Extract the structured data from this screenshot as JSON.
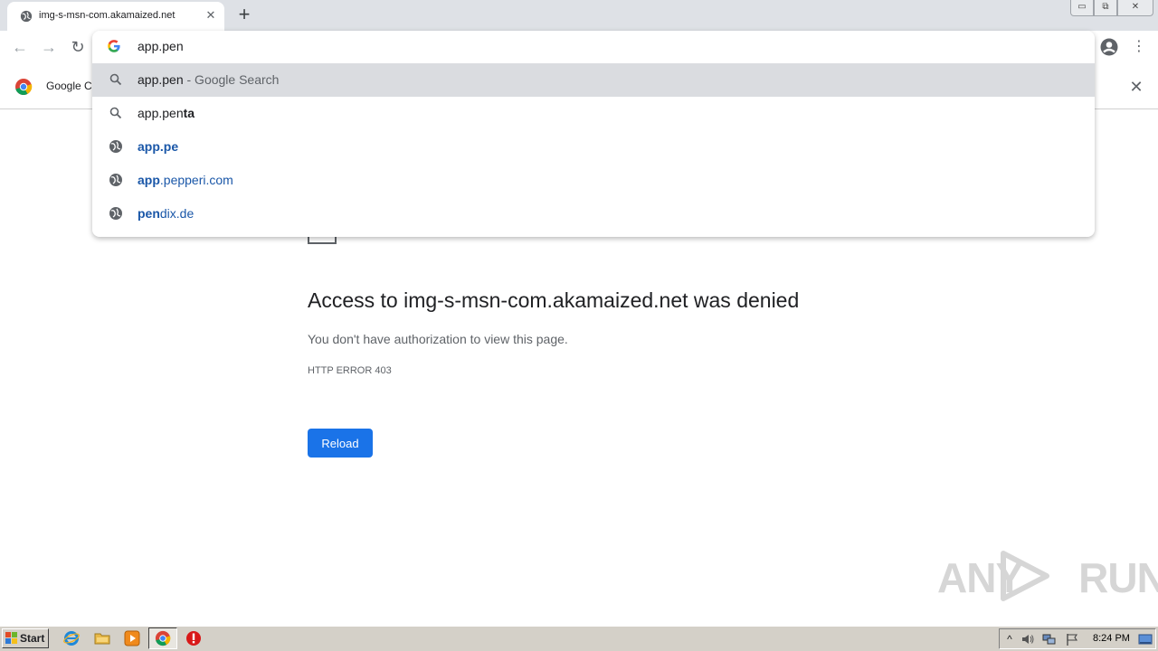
{
  "browser": {
    "tab": {
      "title": "img-s-msn-com.akamaized.net",
      "close": "✕"
    },
    "new_tab": "+",
    "window_controls": {
      "minimize": "▭",
      "maximize": "⧉",
      "close": "✕"
    },
    "nav": {
      "back": "←",
      "forward": "→",
      "reload": "↻"
    },
    "omnibox": {
      "value": "app.pen",
      "suggestions": [
        {
          "icon": "search-icon",
          "main": "app.pen",
          "secondary": " - Google Search",
          "selected": true
        },
        {
          "icon": "search-icon",
          "prefix": "app.pen",
          "completion": "ta"
        },
        {
          "icon": "globe-icon",
          "bold": "app.pe",
          "rest": ""
        },
        {
          "icon": "globe-icon",
          "bold": "app",
          "rest": ".pepperi.com"
        },
        {
          "icon": "globe-icon",
          "bold": "pen",
          "rest": "dix.de"
        }
      ]
    },
    "menu": "⋮"
  },
  "infobar": {
    "text": "Google Cl",
    "close": "✕"
  },
  "error_page": {
    "title": "Access to img-s-msn-com.akamaized.net was denied",
    "message": "You don't have authorization to view this page.",
    "code": "HTTP ERROR 403",
    "reload_label": "Reload"
  },
  "watermark": {
    "left": "ANY",
    "right": "RUN"
  },
  "taskbar": {
    "start_label": "Start",
    "tray": {
      "expand": "^"
    },
    "clock": "8:24 PM"
  },
  "colors": {
    "accent": "#1a73e8",
    "suggestion_link": "#1a57a8",
    "tabstrip": "#dee1e6",
    "taskbar": "#d4d0c8"
  }
}
